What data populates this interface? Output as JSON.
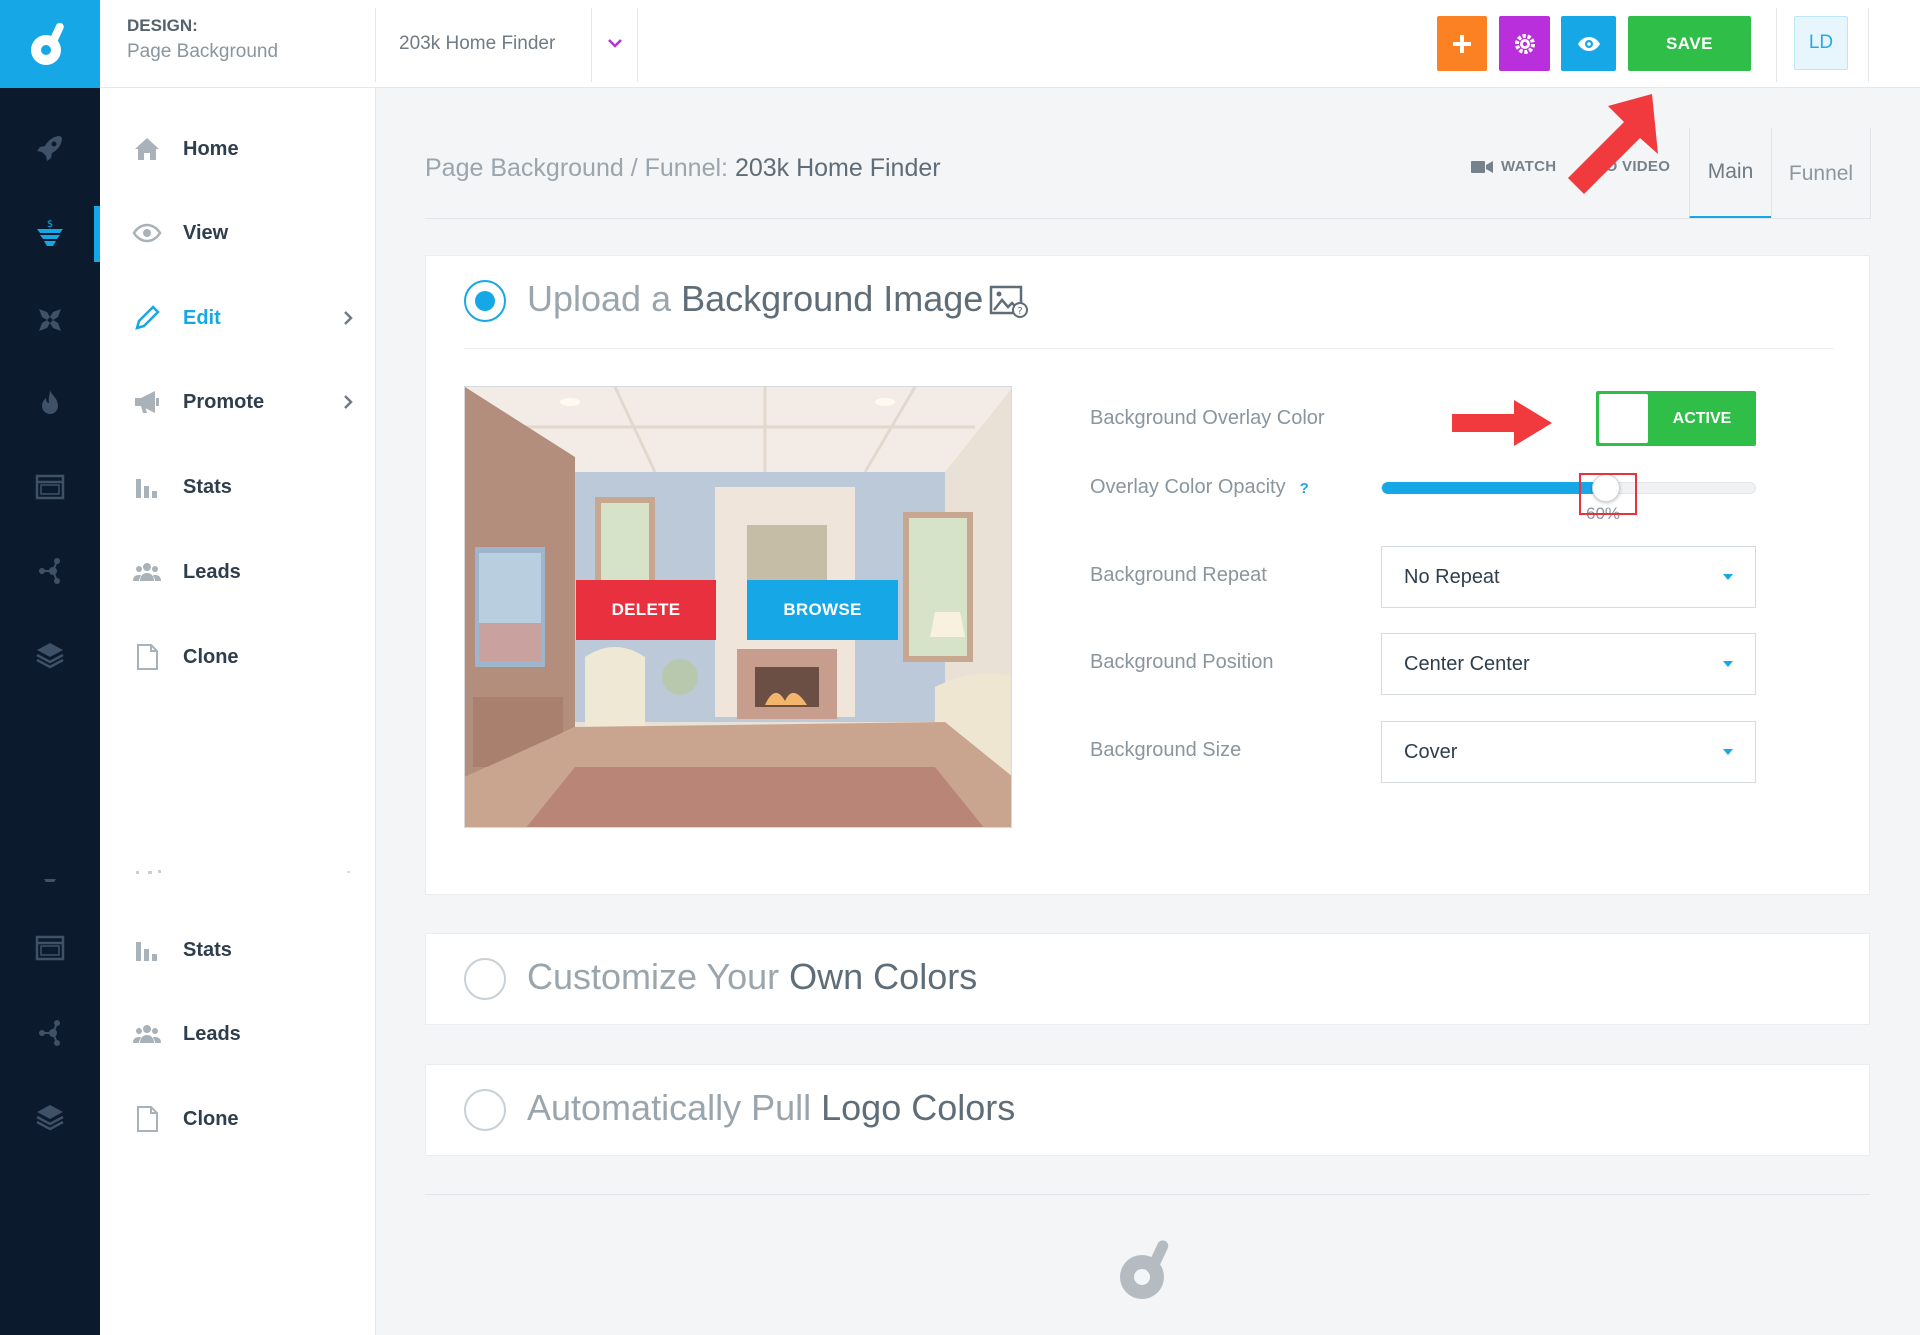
{
  "app": {
    "section_label": "DESIGN:",
    "section_sub": "Page Background",
    "funnel_name": "203k Home Finder",
    "avatar_initials": "LD"
  },
  "toolbar": {
    "save_label": "SAVE"
  },
  "rail": {
    "icons": [
      "rocket-icon",
      "funnel-icon",
      "tools-icon",
      "flame-icon",
      "browser-icon",
      "network-icon",
      "layers-icon",
      "funnel-icon",
      "browser-icon",
      "network-icon",
      "layers-icon"
    ]
  },
  "sidebar": {
    "items": [
      {
        "label": "Home",
        "icon": "home-icon"
      },
      {
        "label": "View",
        "icon": "eye-icon"
      },
      {
        "label": "Edit",
        "icon": "pencil-icon"
      },
      {
        "label": "Promote",
        "icon": "megaphone-icon"
      },
      {
        "label": "Stats",
        "icon": "bar-chart-icon"
      },
      {
        "label": "Leads",
        "icon": "people-icon"
      },
      {
        "label": "Clone",
        "icon": "document-icon"
      },
      {
        "label": "Stats",
        "icon": "bar-chart-icon"
      },
      {
        "label": "Leads",
        "icon": "people-icon"
      },
      {
        "label": "Clone",
        "icon": "document-icon"
      }
    ]
  },
  "header": {
    "breadcrumb_prefix": "Page Background / Funnel: ",
    "breadcrumb_name": "203k Home Finder",
    "watch_left": "WATCH",
    "watch_right": "TO VIDEO",
    "tabs": [
      {
        "label": "Main"
      },
      {
        "label": "Funnel"
      }
    ]
  },
  "upload": {
    "title_pre": "Upload a ",
    "title_emph": "Background Image",
    "delete_label": "DELETE",
    "browse_label": "BROWSE",
    "overlay_label": "Background Overlay Color",
    "overlay_toggle": "ACTIVE",
    "opacity_label": "Overlay Color Opacity",
    "opacity_help": "?",
    "opacity_value": "60%",
    "opacity_fraction": 0.6,
    "repeat_label": "Background Repeat",
    "repeat_value": "No Repeat",
    "position_label": "Background Position",
    "position_value": "Center Center",
    "size_label": "Background Size",
    "size_value": "Cover"
  },
  "custom": {
    "title_pre": "Customize Your ",
    "title_emph": "Own Colors"
  },
  "logo_colors": {
    "title_pre": "Automatically Pull ",
    "title_emph": "Logo Colors"
  },
  "colors": {
    "accent": "#16a8e6",
    "save": "#2fbe47",
    "add": "#fb8123",
    "settings": "#b92fdb",
    "delete": "#e8303e",
    "annotation": "#f03a3e",
    "rail_bg": "#0c1a2d"
  }
}
